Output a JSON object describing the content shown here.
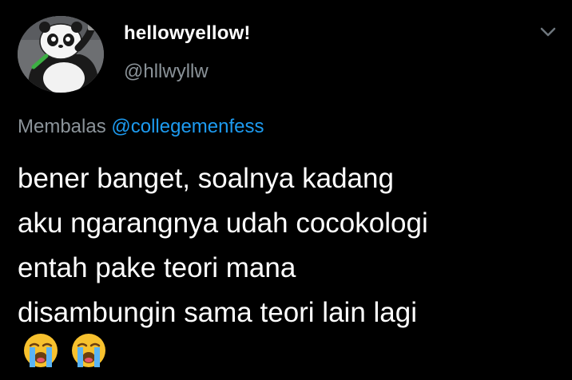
{
  "tweet": {
    "display_name": "hellowyellow!",
    "handle": "@hllwyllw",
    "reply_prefix": "Membalas",
    "reply_mention": "@collegemenfess",
    "body_lines": [
      "bener banget, soalnya kadang",
      "aku ngarangnya udah cocokologi",
      "entah pake teori mana",
      "disambungin sama teori lain lagi"
    ],
    "emojis": [
      "loudly-crying-face-emoji",
      "loudly-crying-face-emoji"
    ]
  },
  "icons": {
    "menu": "chevron-down-icon",
    "avatar": "panda-cartoon-avatar"
  },
  "colors": {
    "background": "#000000",
    "text_primary": "#ffffff",
    "text_secondary": "#8b9399",
    "link": "#1d9bf0"
  }
}
